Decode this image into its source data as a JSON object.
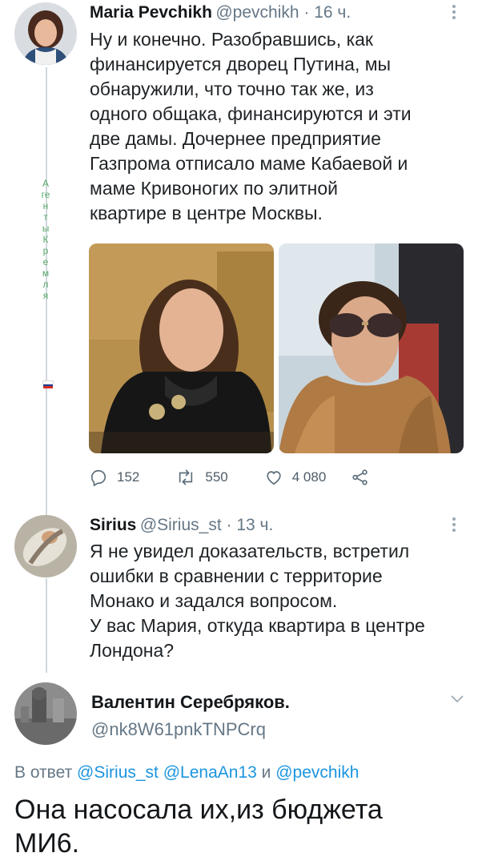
{
  "tweet1": {
    "author_name": "Maria Pevchikh",
    "handle_time": "@pevchikh · 16 ч.",
    "text_lines": [
      "Ну и конечно. Разобравшись, как",
      "финансируется дворец Путина, мы",
      "обнаружили, что точно так же, из",
      "одного общака, финансируются и эти",
      "две дамы. Дочернее предприятие",
      "Газпрома отписало маме Кабаевой и",
      "маме Кривоногих по элитной",
      "квартире в центре Москвы."
    ],
    "replies": "152",
    "retweets": "550",
    "likes": "4 080"
  },
  "thread_side_text": "Агенты Кремля",
  "tweet2": {
    "author_name": "Sirius",
    "handle_time": "@Sirius_st · 13 ч.",
    "text_lines": [
      "Я не увидел доказательств, встретил",
      "ошибки в сравнении с территорие",
      "Монако и задался вопросом.",
      "У вас Мария, откуда квартира в центре",
      "Лондона?"
    ]
  },
  "tweet3": {
    "author_name": "Валентин Серебряков.",
    "handle": "@nk8W61pnkTNPCrq",
    "reply_prefix": "В ответ ",
    "reply_mentions": "@Sirius_st @LenaAn13",
    "reply_and": " и ",
    "reply_last": "@pevchikh",
    "text_lines": [
      "Она насосала их,из бюджета",
      "МИ6."
    ]
  },
  "colors": {
    "link": "#1b95e0",
    "muted": "#657786",
    "thread_line": "#d0d8de",
    "side_text": "#59a869"
  },
  "icons": [
    "reply-icon",
    "retweet-icon",
    "like-icon",
    "share-icon",
    "more-vertical-icon",
    "chevron-down-icon",
    "russian-flag-icon"
  ]
}
